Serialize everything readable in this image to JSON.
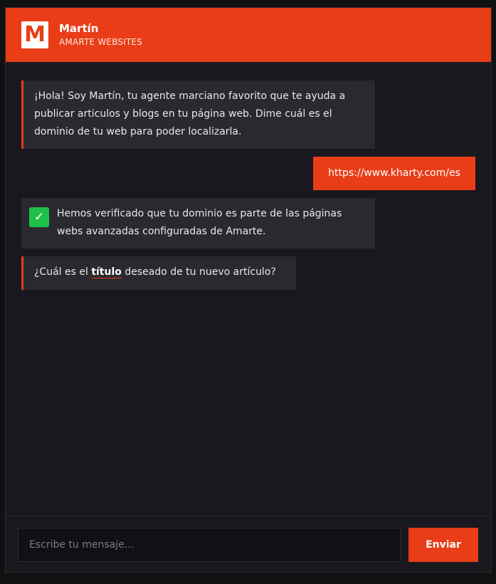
{
  "header": {
    "logo_letter": "M",
    "agent_name": "Martín",
    "agent_org": "AMARTE WEBSITES"
  },
  "messages": {
    "greeting": "¡Hola! Soy Martín, tu agente marciano favorito que te ayuda a publicar articulos y blogs en tu página web. Dime cuál es el dominio de tu web para poder localizarla.",
    "user_domain": "https://www.kharty.com/es",
    "verified": "Hemos verificado que tu dominio es parte de las páginas webs avanzadas configuradas de Amarte.",
    "question_before": "¿Cuál es el ",
    "question_highlight": "título",
    "question_after": " deseado de tu nuevo artículo?"
  },
  "composer": {
    "placeholder": "Escribe tu mensaje...",
    "send_label": "Enviar"
  },
  "icons": {
    "logo": "m-logo-icon",
    "verified": "check-icon"
  },
  "colors": {
    "accent": "#e83d17",
    "success": "#1fc14a",
    "background": "#19181e",
    "bubble": "#2a292f"
  }
}
